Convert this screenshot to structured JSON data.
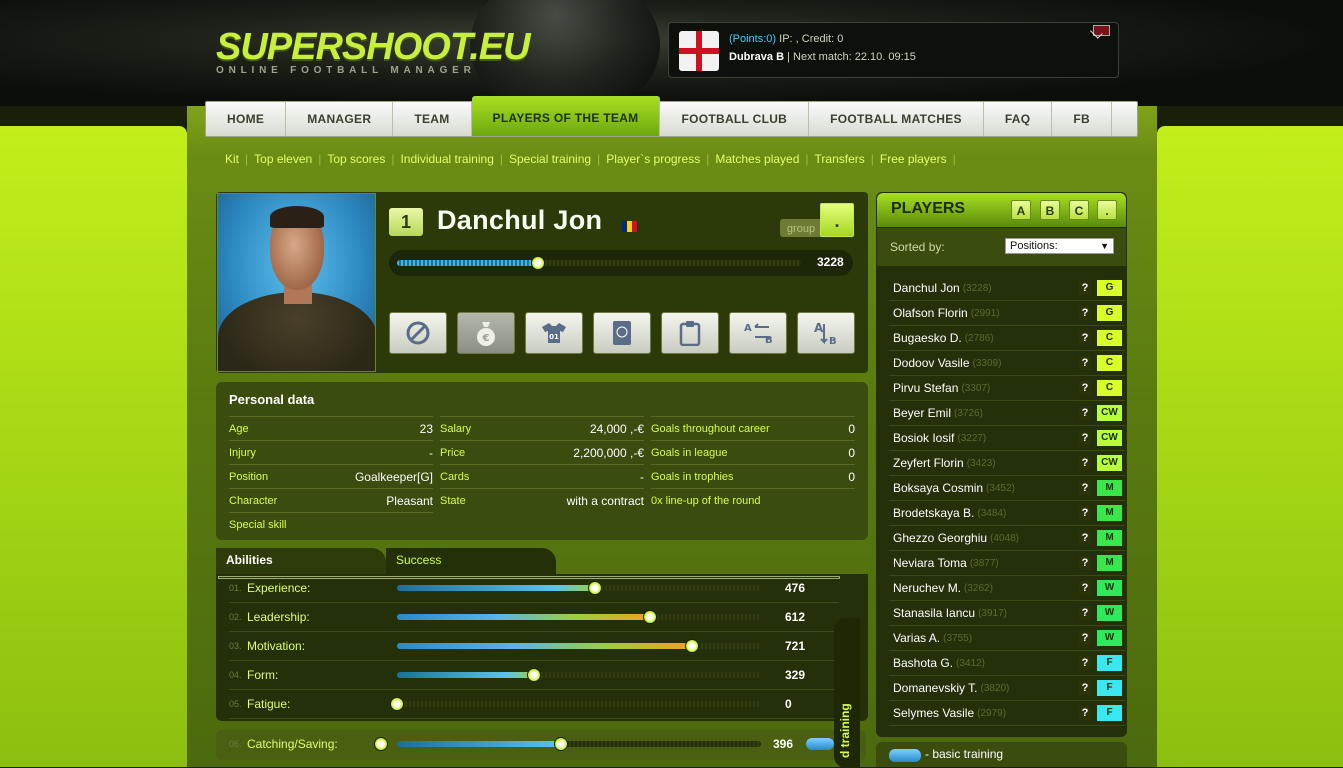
{
  "header": {
    "logo": "SUPERSHOOT.EU",
    "logo_sub": "ONLINE FOOTBALL MANAGER",
    "points": "(Points:0)",
    "ip_credit": "IP: , Credit: 0",
    "team": "Dubrava B",
    "next_match": "| Next match: 22.10. 09:15"
  },
  "nav": [
    "HOME",
    "MANAGER",
    "TEAM",
    "PLAYERS OF THE TEAM",
    "FOOTBALL CLUB",
    "FOOTBALL MATCHES",
    "FAQ",
    "FB"
  ],
  "subnav": [
    "Kit",
    "Top eleven",
    "Top scores",
    "Individual training",
    "Special training",
    "Player`s progress",
    "Matches played",
    "Transfers",
    "Free players"
  ],
  "player": {
    "number": "1",
    "name": "Danchul  Jon",
    "group_label": "group",
    "group_value": ".",
    "rating": "3228",
    "rating_fraction": 0.35
  },
  "personal": {
    "title": "Personal data",
    "col1": [
      {
        "label": "Age",
        "value": "23"
      },
      {
        "label": "Injury",
        "value": "-"
      },
      {
        "label": "Position",
        "value": "Goalkeeper[G]"
      },
      {
        "label": "Character",
        "value": "Pleasant"
      },
      {
        "label": "Special skill",
        "value": ""
      }
    ],
    "col2": [
      {
        "label": "Salary",
        "value": "24,000 ,-€"
      },
      {
        "label": "Price",
        "value": "2,200,000 ,-€"
      },
      {
        "label": "Cards",
        "value": "-"
      },
      {
        "label": "State",
        "value": "with a contract"
      }
    ],
    "col3": [
      {
        "label": "Goals throughout career",
        "value": "0"
      },
      {
        "label": "Goals in league",
        "value": "0"
      },
      {
        "label": "Goals in trophies",
        "value": "0"
      },
      {
        "label": "0x line-up of the round",
        "value": ""
      }
    ]
  },
  "tabs": {
    "active": "Abilities",
    "other": "Success"
  },
  "abilities": [
    {
      "num": "01.",
      "label": "Experience:",
      "value": "476",
      "frac": 0.545,
      "color": "blue"
    },
    {
      "num": "02.",
      "label": "Leadership:",
      "value": "612",
      "frac": 0.695,
      "color": "orange"
    },
    {
      "num": "03.",
      "label": "Motivation:",
      "value": "721",
      "frac": 0.81,
      "color": "orange"
    },
    {
      "num": "04.",
      "label": "Form:",
      "value": "329",
      "frac": 0.375,
      "color": "blue"
    },
    {
      "num": "05.",
      "label": "Fatigue:",
      "value": "0",
      "frac": 0.0,
      "color": "blue"
    }
  ],
  "training": {
    "num": "06.",
    "label": "Catching/Saving:",
    "value": "396",
    "frac": 0.45
  },
  "sidetab": "d training",
  "players_panel": {
    "title": "PLAYERS",
    "letters": [
      "A",
      "B",
      "C",
      "."
    ],
    "sorted_label": "Sorted by:",
    "sorted_value": "Positions:",
    "legend": "- basic training"
  },
  "players": [
    {
      "name": "Danchul Jon",
      "score": "(3228)",
      "pos": "G"
    },
    {
      "name": "Olafson Florin",
      "score": "(2991)",
      "pos": "G"
    },
    {
      "name": "Bugaesko D.",
      "score": "(2786)",
      "pos": "C"
    },
    {
      "name": "Dodoov Vasile",
      "score": "(3309)",
      "pos": "C"
    },
    {
      "name": "Pirvu Stefan",
      "score": "(3307)",
      "pos": "C"
    },
    {
      "name": "Beyer Emil",
      "score": "(3726)",
      "pos": "CW"
    },
    {
      "name": "Bosiok Iosif",
      "score": "(3227)",
      "pos": "CW"
    },
    {
      "name": "Zeyfert Florin",
      "score": "(3423)",
      "pos": "CW"
    },
    {
      "name": "Boksaya Cosmin",
      "score": "(3452)",
      "pos": "M"
    },
    {
      "name": "Brodetskaya B.",
      "score": "(3484)",
      "pos": "M"
    },
    {
      "name": "Ghezzo Georghiu",
      "score": "(4048)",
      "pos": "M"
    },
    {
      "name": "Neviara Toma",
      "score": "(3877)",
      "pos": "M"
    },
    {
      "name": "Neruchev M.",
      "score": "(3262)",
      "pos": "W"
    },
    {
      "name": "Stanasila Iancu",
      "score": "(3917)",
      "pos": "W"
    },
    {
      "name": "Varias A.",
      "score": "(3755)",
      "pos": "W"
    },
    {
      "name": "Bashota G.",
      "score": "(3412)",
      "pos": "F"
    },
    {
      "name": "Domanevskiy T.",
      "score": "(3820)",
      "pos": "F"
    },
    {
      "name": "Selymes Vasile",
      "score": "(2979)",
      "pos": "F"
    }
  ],
  "colors": {
    "G": "#d8ff2a",
    "C": "#d8ff2a",
    "CW": "#b8ff3a",
    "M": "#38e848",
    "W": "#30e85c",
    "F": "#38e8f0"
  }
}
